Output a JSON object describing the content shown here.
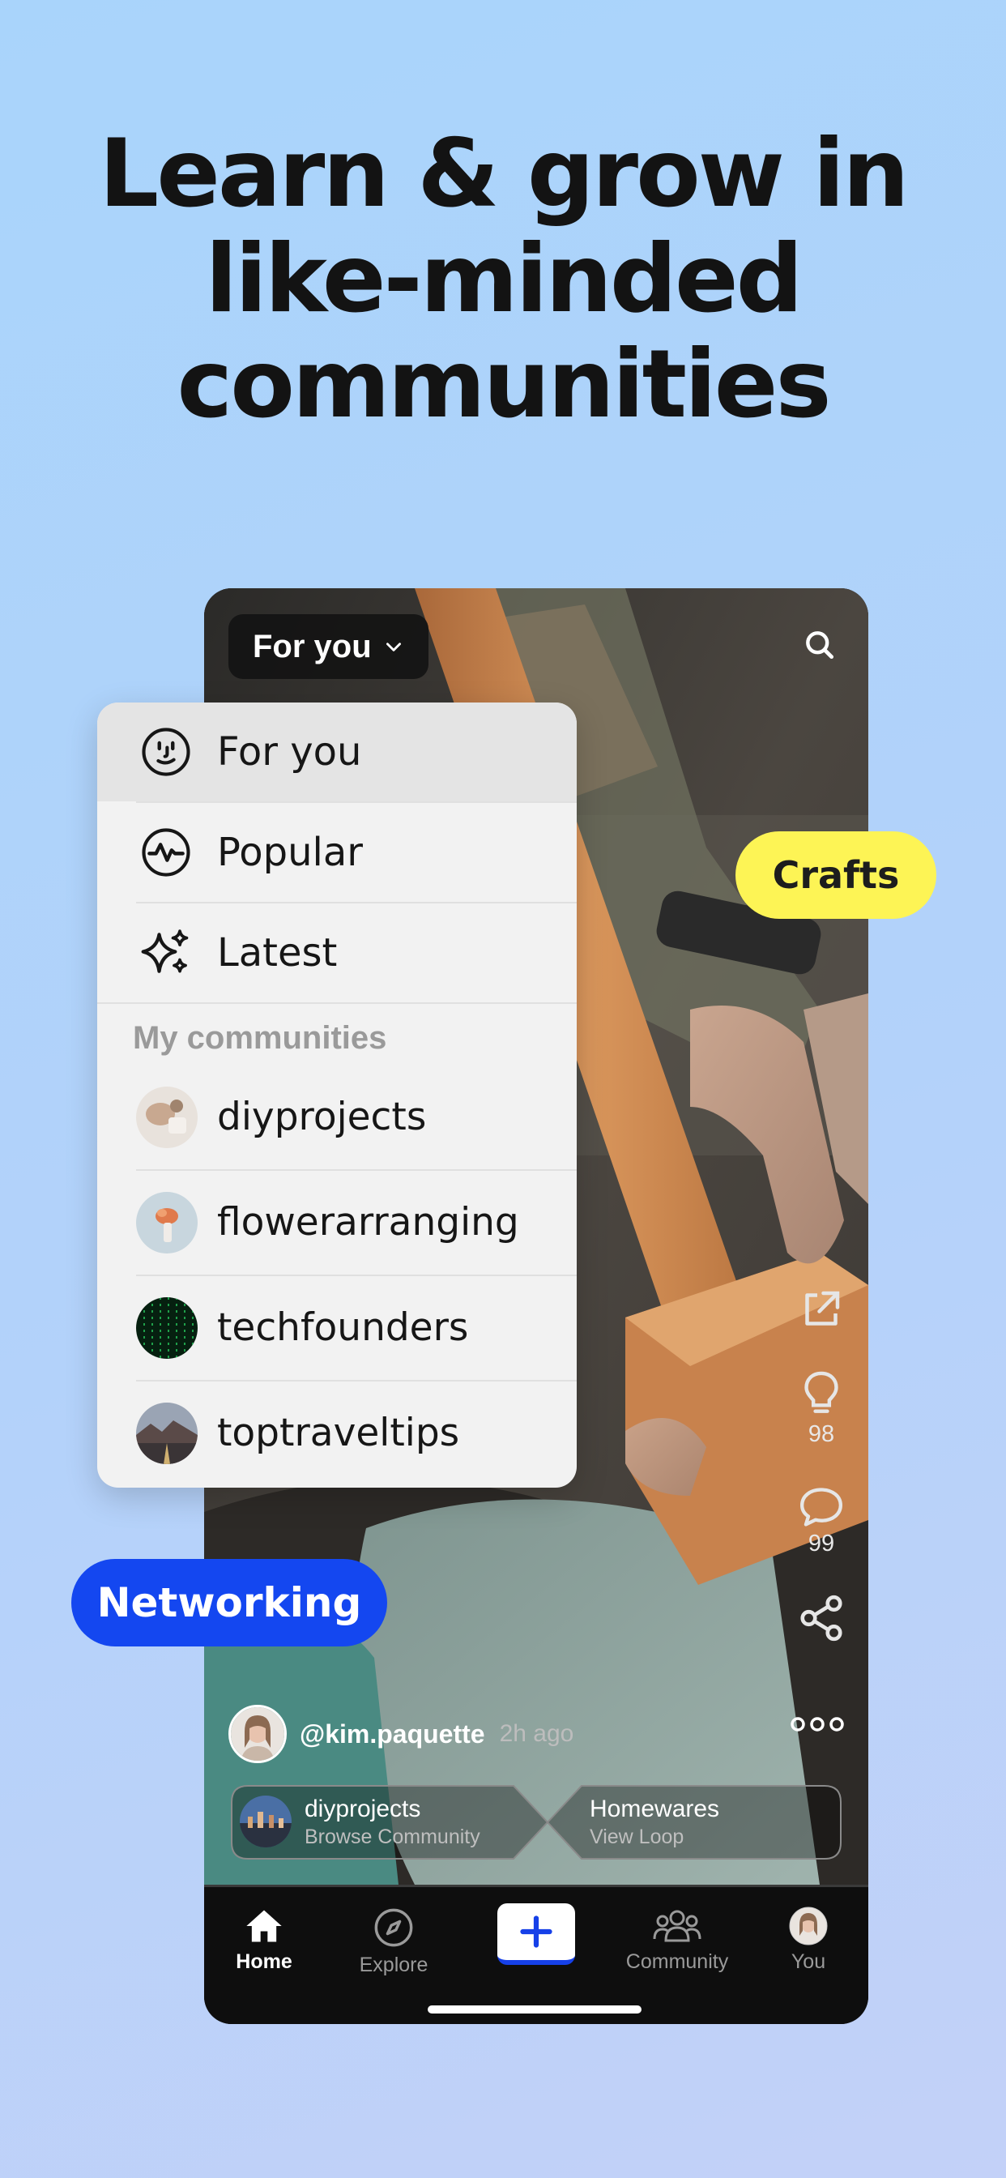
{
  "headline": {
    "line1": "Learn & grow in",
    "line2": "like-minded",
    "line3": "communities"
  },
  "topbar": {
    "feed_label": "For you",
    "search_icon": "search-icon"
  },
  "menu": {
    "feeds": [
      {
        "label": "For you",
        "icon": "smiley-icon",
        "selected": true
      },
      {
        "label": "Popular",
        "icon": "pulse-icon",
        "selected": false
      },
      {
        "label": "Latest",
        "icon": "sparkles-icon",
        "selected": false
      }
    ],
    "section_title": "My communities",
    "communities": [
      {
        "label": "diyprojects"
      },
      {
        "label": "flowerarranging"
      },
      {
        "label": "techfounders"
      },
      {
        "label": "toptraveltips"
      }
    ]
  },
  "tags": {
    "crafts": "Crafts",
    "networking": "Networking"
  },
  "actions": {
    "likes": "98",
    "comments": "99"
  },
  "post": {
    "author": "@kim.paquette",
    "time": "2h ago",
    "community_title": "diyprojects",
    "community_sub": "Browse Community",
    "loop_title": "Homewares",
    "loop_sub": "View Loop"
  },
  "tabbar": {
    "home": "Home",
    "explore": "Explore",
    "community": "Community",
    "you": "You"
  },
  "colors": {
    "accent_blue": "#1447f0",
    "crafts_yellow": "#fdf455"
  }
}
